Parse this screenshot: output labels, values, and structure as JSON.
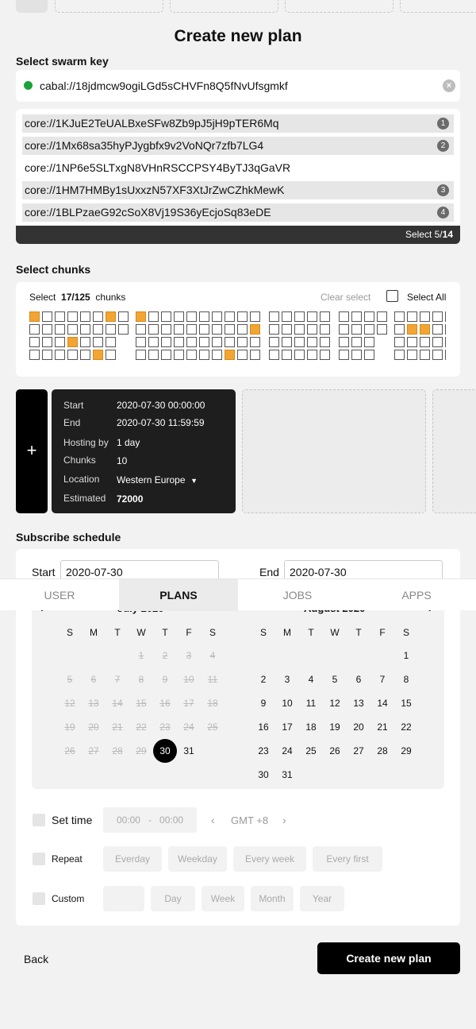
{
  "title": "Create new plan",
  "swarm": {
    "heading": "Select swarm key",
    "key": "cabal://18jdmcw9ogiLGd5sCHVFn8Q5fNvUfsgmkf",
    "clear_icon": "close-icon",
    "cores": [
      {
        "key": "core://1KJuE2TeUALBxeSFw8Zb9pJ5jH9pTER6Mq",
        "badge": "1",
        "selected": true
      },
      {
        "key": "core://1Mx68sa35hyPJygbfx9v2VoNQr7zfb7LG4",
        "badge": "2",
        "selected": true
      },
      {
        "key": "core://1NP6e5SLTxgN8VHnRSCCPSY4ByTJ3qGaVR",
        "badge": "",
        "selected": false
      },
      {
        "key": "core://1HM7HMBy1sUxxzN57XF3XtJrZwCZhkMewK",
        "badge": "3",
        "selected": true
      },
      {
        "key": "core://1BLPzaeG92cSoX8Vj19S36yEcjoSq83eDE",
        "badge": "4",
        "selected": true
      }
    ],
    "footer_prefix": "Select 5/",
    "footer_total": "14"
  },
  "chunks": {
    "heading": "Select chunks",
    "select_label": "Select",
    "count": "17/125",
    "unit": "chunks",
    "clear": "Clear select",
    "select_all": "Select All",
    "highlight_color": "#f3a534"
  },
  "plan": {
    "add_label": "+",
    "rows": [
      {
        "k": "Start",
        "v": "2020-07-30 00:00:00"
      },
      {
        "k": "End",
        "v": "2020-07-30 11:59:59"
      },
      {
        "k": "Hosting by",
        "v": "1 day"
      },
      {
        "k": "Chunks",
        "v": "10"
      },
      {
        "k": "Location",
        "v": "Western Europe"
      },
      {
        "k": "Estimated",
        "v": "72000"
      }
    ]
  },
  "schedule": {
    "heading": "Subscribe schedule",
    "start_label": "Start",
    "start_value": "2020-07-30",
    "end_label": "End",
    "end_value": "2020-07-30",
    "cal_left_title": "July 2020",
    "cal_right_title": "August 2020",
    "dow": [
      "S",
      "M",
      "T",
      "W",
      "T",
      "F",
      "S"
    ],
    "set_time": "Set time",
    "time_from": "00:00",
    "time_sep": "-",
    "time_to": "00:00",
    "tz": "GMT +8",
    "repeat": "Repeat",
    "repeat_opts": [
      "Everday",
      "Weekday",
      "Every week",
      "Every first"
    ],
    "custom": "Custom",
    "custom_opts": [
      "Day",
      "Week",
      "Month",
      "Year"
    ]
  },
  "tabs": [
    {
      "label": "USER",
      "active": false
    },
    {
      "label": "PLANS",
      "active": true
    },
    {
      "label": "JOBS",
      "active": false
    },
    {
      "label": "APPS",
      "active": false
    }
  ],
  "actions": {
    "back": "Back",
    "create": "Create new plan"
  }
}
